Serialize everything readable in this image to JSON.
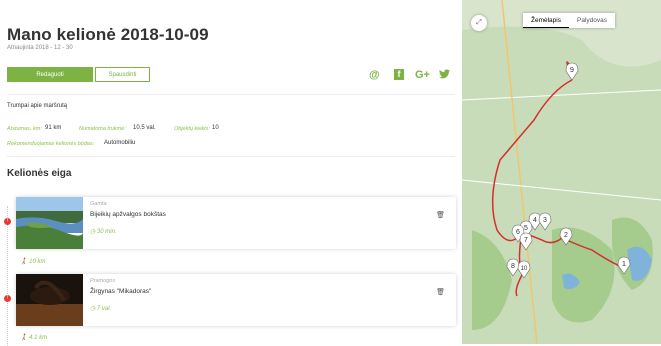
{
  "page": {
    "title": "Mano kelionė 2018-10-09",
    "subtitle": "Atnaujinta 2018 - 12 - 30"
  },
  "actions": {
    "edit_label": "Redaguoti",
    "print_label": "Spausdinti",
    "share_icons": [
      "email-icon",
      "facebook-icon",
      "google-plus-icon",
      "twitter-icon"
    ],
    "share_glyphs": [
      "@",
      "f",
      "G+",
      "🐦"
    ]
  },
  "summary": {
    "title": "Trumpai apie maršrutą",
    "distance_label": "Atstumas, km:",
    "distance_value": "91 km",
    "time_label": "Numatoma trukmė:",
    "time_value": "10.5 val.",
    "objects_label": "Objektų kiekis:",
    "objects_value": "10",
    "transport_label": "Rekomenduojamas kelionės būdas:",
    "transport_value": "Automobiliu"
  },
  "itinerary": {
    "title": "Kelionės eiga",
    "items": [
      {
        "category": "Gamta",
        "name": "Bijeikių apžvalgos bokštas",
        "duration": "30 min.",
        "distance_after": "10 km"
      },
      {
        "category": "Pramogos",
        "name": "Žirgynas \"Mikadoras\"",
        "duration": "7 val.",
        "distance_after": "4.1 km"
      }
    ]
  },
  "map": {
    "tabs": [
      {
        "label": "Žemėlapis",
        "active": true
      },
      {
        "label": "Palydovas",
        "active": false
      }
    ],
    "markers": [
      "9",
      "4",
      "3",
      "5",
      "6",
      "7",
      "2",
      "8",
      "10",
      "1"
    ]
  },
  "colors": {
    "accent": "#7cb342",
    "bullet": "#e53935",
    "map_route": "#d32f2f"
  }
}
